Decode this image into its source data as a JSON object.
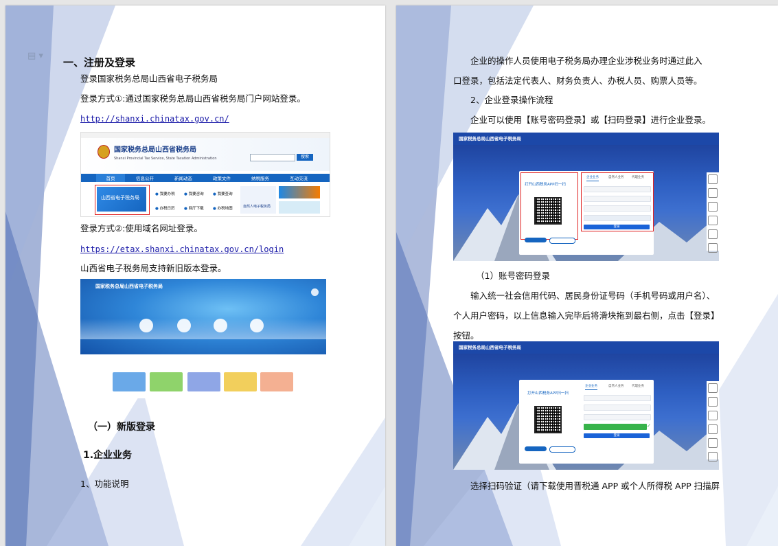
{
  "left_page": {
    "heading1": "一、注册及登录",
    "p1": "登录国家税务总局山西省电子税务局",
    "p2": "登录方式①:通过国家税务总局山西省税务局门户网站登录。",
    "link1": "http://shanxi.chinatax.gov.cn/",
    "portal": {
      "site_title": "国家税务总局山西省税务局",
      "site_subtitle": "Shanxi Provincial Tax Service, State Taxation Administration",
      "search_button": "搜索",
      "nav": [
        "首页",
        "信息公开",
        "新闻动态",
        "政策文件",
        "纳税服务",
        "互动交流"
      ],
      "etax_tile": "山西省电子税务局",
      "services": [
        "我要办税",
        "我要咨询",
        "我要查询",
        "办税日历",
        "网厅下载",
        "办税地图"
      ],
      "ad_text": "自然人电子税务局"
    },
    "p3": "登录方式②:使用域名网址登录。",
    "link2": "https://etax.shanxi.chinatax.gov.cn/login",
    "p4": "山西省电子税务局支持新旧版本登录。",
    "etax_header": "国家税务总局山西省电子税务局",
    "heading2": "（一）新版登录",
    "heading3": "1.企业业务",
    "p5": "1、功能说明"
  },
  "right_page": {
    "p1_line1": "企业的操作人员使用电子税务局办理企业涉税业务时通过此入",
    "p1_line2": "口登录，包括法定代表人、财务负责人、办税人员、购票人员等。",
    "p2": "2、企业登录操作流程",
    "p3": "企业可以使用【账号密码登录】或【扫码登录】进行企业登录。",
    "login_header": "国家税务总局山西省电子税务局",
    "login_tabs": [
      "企业业务",
      "自然人业务",
      "代理业务"
    ],
    "login_button": "登录",
    "scan_title": "打开山西税务APP扫一扫",
    "p4": "（1）账号密码登录",
    "p5_line1": "输入统一社会信用代码、居民身份证号码（手机号码或用户名）、",
    "p5_line2": "个人用户密码，以上信息输入完毕后将滑块拖到最右侧，点击【登录】",
    "p5_line3": "按钮。",
    "p6": "选择扫码验证（请下载使用晋税通 APP 或个人所得税 APP 扫描屏"
  },
  "colors": {
    "accent_blue": "#1565c0",
    "highlight_red": "#e02020",
    "link_blue": "#1a1aa8"
  }
}
